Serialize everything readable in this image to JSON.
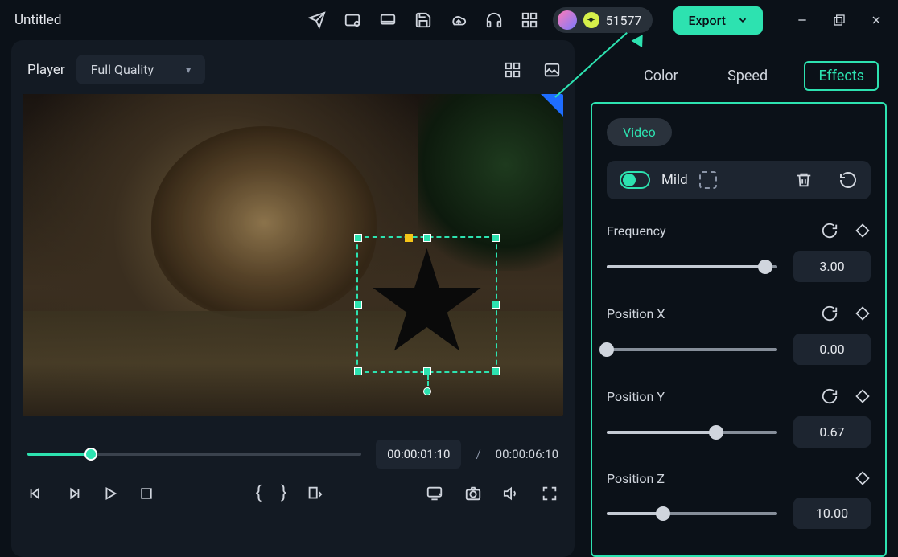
{
  "title": "Untitled",
  "credits": "51577",
  "export_label": "Export",
  "player": {
    "label": "Player",
    "quality": "Full Quality",
    "currentTime": "00:00:01:10",
    "duration": "00:00:06:10",
    "progressPercent": 19
  },
  "tabs": {
    "color": "Color",
    "speed": "Speed",
    "effects": "Effects",
    "active": "effects"
  },
  "effects": {
    "group_label": "Video",
    "effect_name": "Mild",
    "enabled": true,
    "params": [
      {
        "label": "Frequency",
        "value": "3.00",
        "percent": 93,
        "hasReset": true,
        "hasKey": true
      },
      {
        "label": "Position X",
        "value": "0.00",
        "percent": 0,
        "hasReset": true,
        "hasKey": true
      },
      {
        "label": "Position Y",
        "value": "0.67",
        "percent": 64,
        "hasReset": true,
        "hasKey": true
      },
      {
        "label": "Position Z",
        "value": "10.00",
        "percent": 33,
        "hasReset": false,
        "hasKey": true
      }
    ]
  }
}
